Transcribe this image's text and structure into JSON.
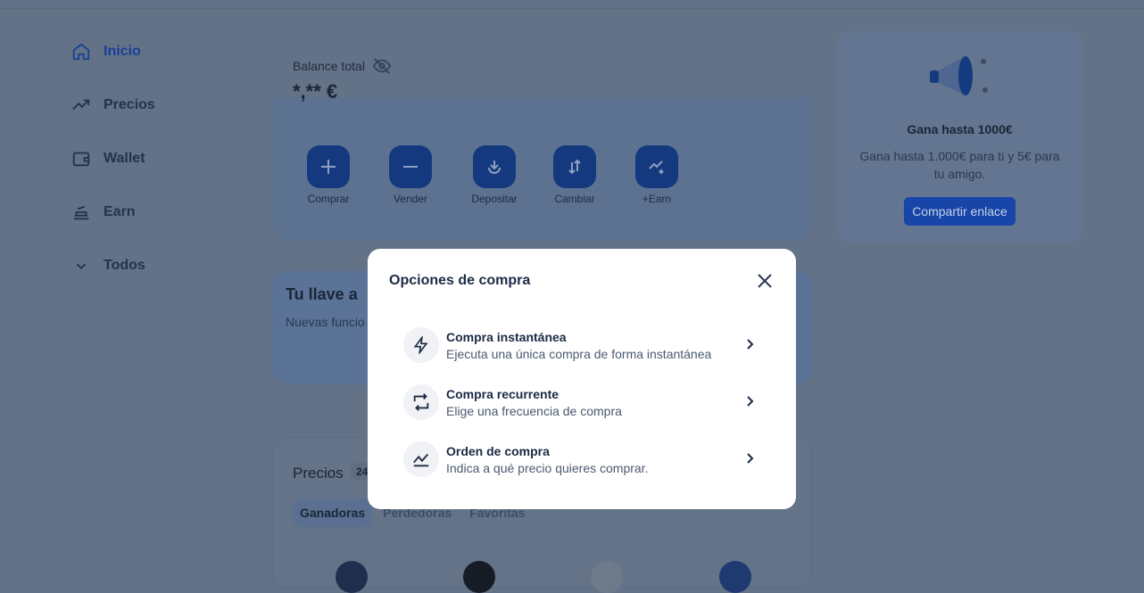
{
  "sidebar": {
    "items": [
      {
        "label": "Inicio",
        "icon": "home-icon",
        "active": true
      },
      {
        "label": "Precios",
        "icon": "trending-up-icon"
      },
      {
        "label": "Wallet",
        "icon": "wallet-icon"
      },
      {
        "label": "Earn",
        "icon": "earn-icon"
      },
      {
        "label": "Todos",
        "icon": "chevron-down-icon"
      }
    ]
  },
  "balance": {
    "label": "Balance total",
    "value": "*,** €",
    "actions": [
      {
        "label": "Comprar",
        "icon": "plus-icon"
      },
      {
        "label": "Vender",
        "icon": "minus-icon"
      },
      {
        "label": "Depositar",
        "icon": "deposit-icon"
      },
      {
        "label": "Cambiar",
        "icon": "swap-icon"
      },
      {
        "label": "+Earn",
        "icon": "earn-plus-icon"
      }
    ]
  },
  "promo": {
    "title": "Gana hasta 1000€",
    "text": "Gana hasta 1.000€ para ti y 5€ para tu amigo.",
    "button": "Compartir enlace"
  },
  "banner": {
    "title": "Tu llave a",
    "text": "Nuevas funcio"
  },
  "prices": {
    "title": "Precios",
    "badge": "24",
    "tabs": [
      "Ganadoras",
      "Perdedoras",
      "Favoritas"
    ]
  },
  "modal": {
    "title": "Opciones de compra",
    "options": [
      {
        "title": "Compra instantánea",
        "desc": "Ejecuta una única compra de forma instantánea",
        "icon": "lightning-icon"
      },
      {
        "title": "Compra recurrente",
        "desc": "Elige una frecuencia de compra",
        "icon": "repeat-icon"
      },
      {
        "title": "Orden de compra",
        "desc": "Indica a qué precio quieres comprar.",
        "icon": "limit-order-icon"
      }
    ]
  },
  "colors": {
    "accent": "#1d5ae0",
    "overlay": "#637287"
  }
}
